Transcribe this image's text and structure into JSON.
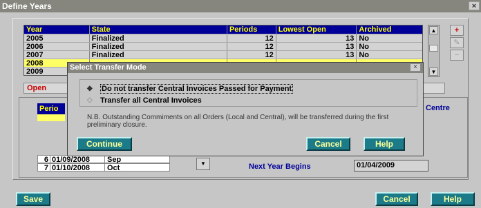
{
  "window": {
    "title": "Define Years",
    "close": "×"
  },
  "years_table": {
    "columns": [
      "Year",
      "State",
      "Periods",
      "Lowest Open",
      "Archived"
    ],
    "rows": [
      {
        "year": "2005",
        "state": "Finalized",
        "periods": "12",
        "lowest_open": "13",
        "archived": "No"
      },
      {
        "year": "2006",
        "state": "Finalized",
        "periods": "12",
        "lowest_open": "13",
        "archived": "No"
      },
      {
        "year": "2007",
        "state": "Finalized",
        "periods": "12",
        "lowest_open": "13",
        "archived": "No"
      },
      {
        "year": "2008",
        "state": "",
        "periods": "",
        "lowest_open": "",
        "archived": ""
      },
      {
        "year": "2009",
        "state": "",
        "periods": "",
        "lowest_open": "",
        "archived": ""
      }
    ]
  },
  "open_button": {
    "label": "Open"
  },
  "periods_panel": {
    "header": "Perio",
    "centre_label": "Centre",
    "rows": [
      {
        "num": "6",
        "date": "01/09/2008",
        "month": "Sep"
      },
      {
        "num": "7",
        "date": "01/10/2008",
        "month": "Oct"
      }
    ],
    "next_year_label": "Next Year Begins",
    "next_year_value": "01/04/2009"
  },
  "footer": {
    "save": "Save",
    "cancel": "Cancel",
    "help": "Help"
  },
  "dialog": {
    "title": "Select Transfer Mode",
    "close": "×",
    "option1": "Do not transfer Central Invoices Passed for Payment",
    "option2": "Transfer all Central Invoices",
    "note": "N.B. Outstanding Commiments on all Orders (Local and Central), will be transferred during the first preliminary closure.",
    "continue": "Continue",
    "cancel": "Cancel",
    "help": "Help"
  },
  "colors": {
    "header_bg": "#000099",
    "header_text": "#ffff00",
    "button_teal": "#1b7b88",
    "selected_row": "#ffff66"
  }
}
